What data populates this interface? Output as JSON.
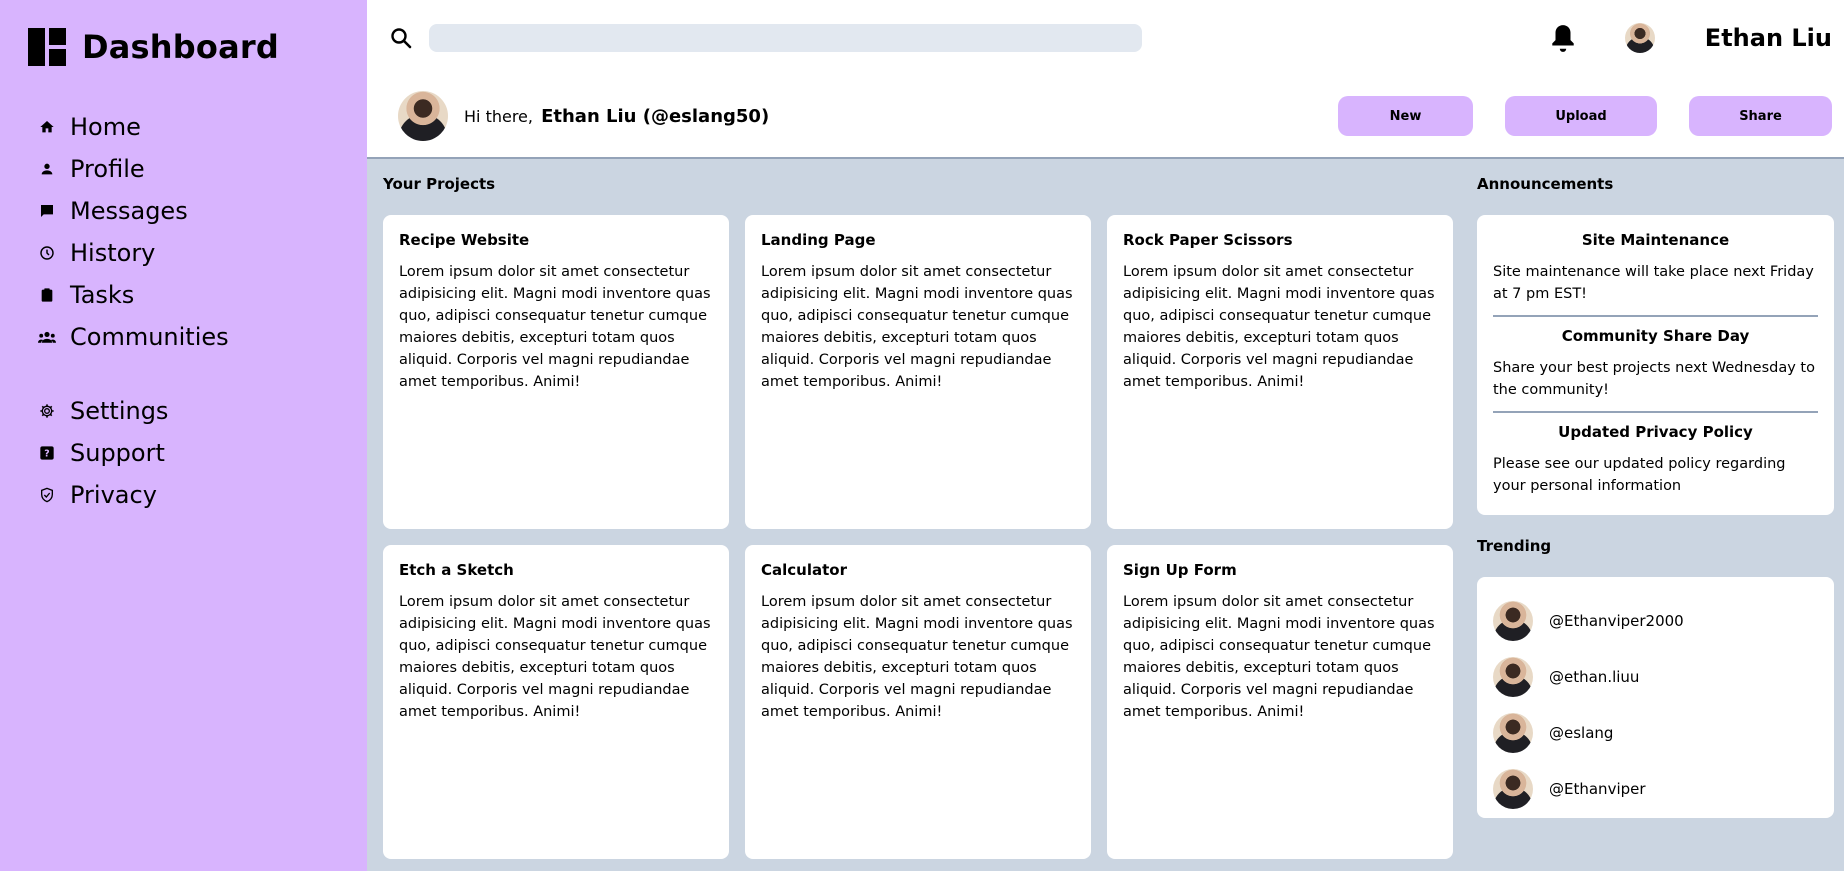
{
  "sidebar": {
    "brand": "Dashboard",
    "items": [
      {
        "label": "Home",
        "icon": "home-icon"
      },
      {
        "label": "Profile",
        "icon": "person-icon"
      },
      {
        "label": "Messages",
        "icon": "message-icon"
      },
      {
        "label": "History",
        "icon": "clock-icon"
      },
      {
        "label": "Tasks",
        "icon": "clipboard-icon"
      },
      {
        "label": "Communities",
        "icon": "group-icon"
      }
    ],
    "secondary_items": [
      {
        "label": "Settings",
        "icon": "gear-icon"
      },
      {
        "label": "Support",
        "icon": "help-icon"
      },
      {
        "label": "Privacy",
        "icon": "shield-icon"
      }
    ]
  },
  "header": {
    "search_placeholder": "",
    "username": "Ethan Liu"
  },
  "greeting": {
    "prefix": "Hi there,",
    "name": "Ethan Liu (@eslang50)",
    "buttons": [
      "New",
      "Upload",
      "Share"
    ]
  },
  "projects": {
    "title": "Your Projects",
    "items": [
      {
        "title": "Recipe Website",
        "body": "Lorem ipsum dolor sit amet consectetur adipisicing elit. Magni modi inventore quas quo, adipisci consequatur tenetur cumque maiores debitis, excepturi totam quos aliquid. Corporis vel magni repudiandae amet temporibus. Animi!"
      },
      {
        "title": "Landing Page",
        "body": "Lorem ipsum dolor sit amet consectetur adipisicing elit. Magni modi inventore quas quo, adipisci consequatur tenetur cumque maiores debitis, excepturi totam quos aliquid. Corporis vel magni repudiandae amet temporibus. Animi!"
      },
      {
        "title": "Rock Paper Scissors",
        "body": "Lorem ipsum dolor sit amet consectetur adipisicing elit. Magni modi inventore quas quo, adipisci consequatur tenetur cumque maiores debitis, excepturi totam quos aliquid. Corporis vel magni repudiandae amet temporibus. Animi!"
      },
      {
        "title": "Etch a Sketch",
        "body": "Lorem ipsum dolor sit amet consectetur adipisicing elit. Magni modi inventore quas quo, adipisci consequatur tenetur cumque maiores debitis, excepturi totam quos aliquid. Corporis vel magni repudiandae amet temporibus. Animi!"
      },
      {
        "title": "Calculator",
        "body": "Lorem ipsum dolor sit amet consectetur adipisicing elit. Magni modi inventore quas quo, adipisci consequatur tenetur cumque maiores debitis, excepturi totam quos aliquid. Corporis vel magni repudiandae amet temporibus. Animi!"
      },
      {
        "title": "Sign Up Form",
        "body": "Lorem ipsum dolor sit amet consectetur adipisicing elit. Magni modi inventore quas quo, adipisci consequatur tenetur cumque maiores debitis, excepturi totam quos aliquid. Corporis vel magni repudiandae amet temporibus. Animi!"
      }
    ]
  },
  "announcements": {
    "title": "Announcements",
    "items": [
      {
        "title": "Site Maintenance",
        "body": "Site maintenance will take place next Friday at 7 pm EST!"
      },
      {
        "title": "Community Share Day",
        "body": "Share your best projects next Wednesday to the community!"
      },
      {
        "title": "Updated Privacy Policy",
        "body": "Please see our updated policy regarding your personal information"
      }
    ]
  },
  "trending": {
    "title": "Trending",
    "items": [
      "@Ethanviper2000",
      "@ethan.liuu",
      "@eslang",
      "@Ethanviper"
    ]
  },
  "colors": {
    "sidebar_bg": "#d8b4fe",
    "content_bg": "#cbd5e1",
    "search_bg": "#e2e8f0",
    "button_bg": "#d8b4fe"
  }
}
